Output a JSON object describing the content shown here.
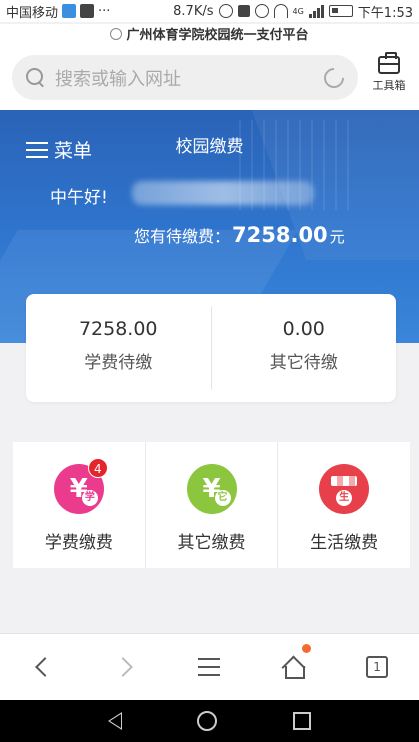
{
  "status_bar": {
    "carrier": "中国移动",
    "ellipsis": "···",
    "speed": "8.7K/s",
    "network": "4G",
    "time": "下午1:53"
  },
  "browser": {
    "url_title": "广州体育学院校园统一支付平台",
    "search_placeholder": "搜索或输入网址",
    "toolbox_label": "工具箱"
  },
  "header": {
    "menu_label": "菜单",
    "title": "校园缴费",
    "greeting": "中午好!",
    "pending_label": "您有待缴费：",
    "pending_amount": "7258.00",
    "pending_unit": "元"
  },
  "summary": {
    "tuition_value": "7258.00",
    "tuition_label": "学费待缴",
    "other_value": "0.00",
    "other_label": "其它待缴"
  },
  "pay_items": [
    {
      "label": "学费缴费",
      "icon_char": "学",
      "badge": "4",
      "color": "#ea3b8d"
    },
    {
      "label": "其它缴费",
      "icon_char": "它",
      "color": "#8cc63f"
    },
    {
      "label": "生活缴费",
      "icon_char": "生",
      "color": "#e8404a"
    }
  ],
  "bottom_nav": {
    "tab_count": "1"
  },
  "colors": {
    "hero": "#2f76cf",
    "notify_dot": "#f36b2e"
  }
}
